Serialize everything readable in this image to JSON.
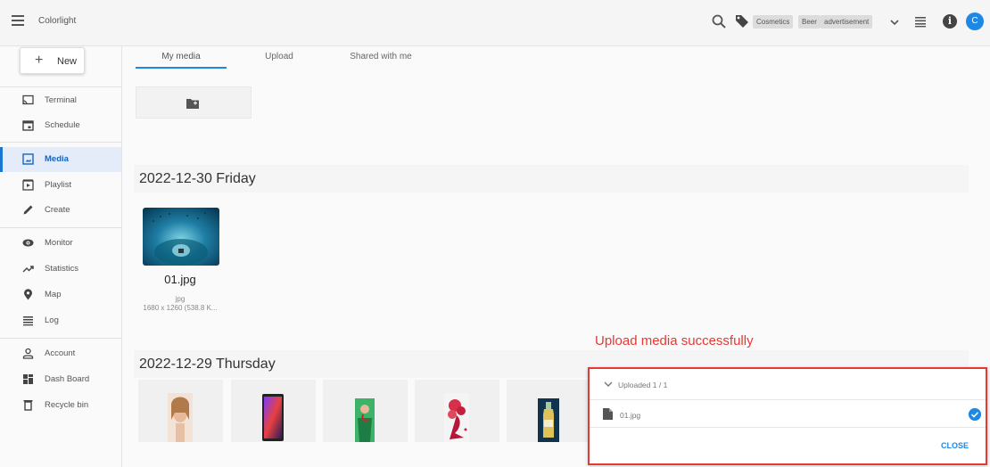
{
  "app": {
    "title": "Colorlight"
  },
  "topbar": {
    "tags": [
      "Cosmetics",
      "Beer",
      "advertisement"
    ],
    "avatar_letter": "C",
    "info_glyph": "i"
  },
  "sidebar": {
    "new_button": {
      "plus": "+",
      "label": "New"
    },
    "items": [
      {
        "label": "Terminal",
        "icon": "cast-icon"
      },
      {
        "label": "Schedule",
        "icon": "calendar-icon"
      },
      {
        "label": "Media",
        "icon": "image-icon",
        "active": true
      },
      {
        "label": "Playlist",
        "icon": "playlist-icon"
      },
      {
        "label": "Create",
        "icon": "pencil-icon"
      },
      {
        "label": "Monitor",
        "icon": "eye-icon"
      },
      {
        "label": "Statistics",
        "icon": "trend-icon"
      },
      {
        "label": "Map",
        "icon": "map-pin-icon"
      },
      {
        "label": "Log",
        "icon": "list-icon"
      },
      {
        "label": "Account",
        "icon": "person-icon"
      },
      {
        "label": "Dash Board",
        "icon": "dashboard-icon"
      },
      {
        "label": "Recycle bin",
        "icon": "trash-icon"
      }
    ]
  },
  "tabs": [
    {
      "label": "My media",
      "active": true
    },
    {
      "label": "Upload"
    },
    {
      "label": "Shared with me"
    }
  ],
  "groups": [
    {
      "date": "2022-12-30 Friday",
      "items": [
        {
          "name": "01.jpg",
          "type": "jpg",
          "info": "1680 x 1260 (538.8 K..."
        }
      ]
    },
    {
      "date": "2022-12-29 Thursday"
    }
  ],
  "annotation": "Upload media successfully",
  "upload_panel": {
    "header": "Uploaded 1 / 1",
    "file": "01.jpg",
    "close_label": "CLOSE"
  },
  "colors": {
    "accent": "#1e88e5",
    "annotation": "#e53935"
  }
}
